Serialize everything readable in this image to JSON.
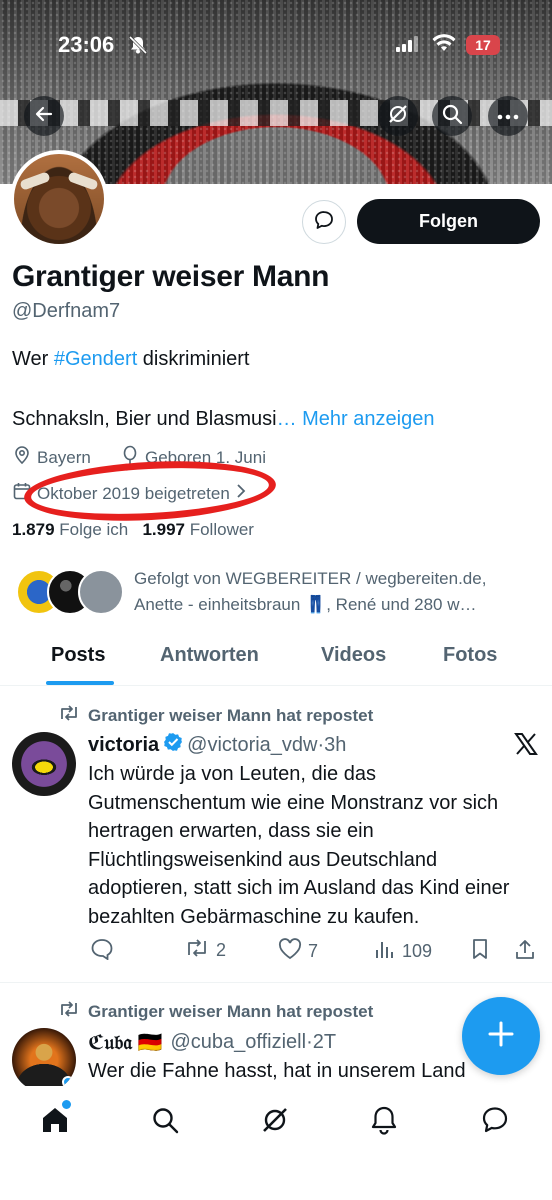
{
  "status_bar": {
    "time": "23:06",
    "battery": "17"
  },
  "profile": {
    "display_name": "Grantiger weiser Mann",
    "handle": "@Derfnam7",
    "follow_label": "Folgen",
    "bio_line1_before": "Wer ",
    "bio_hashtag": "#Gendert",
    "bio_line1_after": " diskriminiert",
    "bio_line2": "Schnaksln, Bier und Blasmusi",
    "bio_more": "… Mehr anzeigen",
    "location": "Bayern",
    "birthday": "Geboren 1. Juni",
    "joined": "Oktober 2019 beigetreten",
    "following_count": "1.879",
    "following_label": "Folge ich",
    "followers_count": "1.997",
    "followers_label": "Follower",
    "followed_by_line1": "Gefolgt von WEGBEREITER / wegbereiten.de,",
    "followed_by_line2": "Anette - einheitsbraun 👖, René und 280 w…"
  },
  "tabs": [
    {
      "label": "Posts",
      "active": true
    },
    {
      "label": "Antworten",
      "active": false
    },
    {
      "label": "Videos",
      "active": false
    },
    {
      "label": "Fotos",
      "active": false
    }
  ],
  "posts": [
    {
      "repost_label": "Grantiger weiser Mann hat repostet",
      "author": "victoria",
      "verified": true,
      "handle": "@victoria_vdw",
      "time": "3h",
      "text": "Ich würde ja von Leuten, die das Gutmenschentum wie eine Monstranz vor sich hertragen erwarten, dass sie ein Flüchtlingsweisenkind aus Deutschland adoptieren, statt sich im Ausland das Kind einer bezahlten Gebärmaschine zu kaufen.",
      "reposts": "2",
      "likes": "7",
      "views": "109"
    },
    {
      "repost_label": "Grantiger weiser Mann hat repostet",
      "author": "ℭ𝔲𝔟𝔞 🇩🇪",
      "handle": "@cuba_offiziell",
      "time": "2T",
      "text": "Wer die Fahne hasst, hat in unserem Land"
    }
  ],
  "colors": {
    "accent": "#1d9bf0",
    "text": "#0f1419",
    "muted": "#536471",
    "highlight_circle": "#e6201e"
  },
  "icons": [
    "back-arrow-icon",
    "grok-icon",
    "search-icon",
    "more-icon",
    "message-icon",
    "location-pin-icon",
    "balloon-icon",
    "calendar-icon",
    "chevron-right-icon",
    "repost-icon",
    "verified-icon",
    "x-logo-icon",
    "reply-icon",
    "like-icon",
    "views-icon",
    "bookmark-icon",
    "share-icon",
    "plus-icon",
    "home-icon",
    "notifications-icon"
  ]
}
